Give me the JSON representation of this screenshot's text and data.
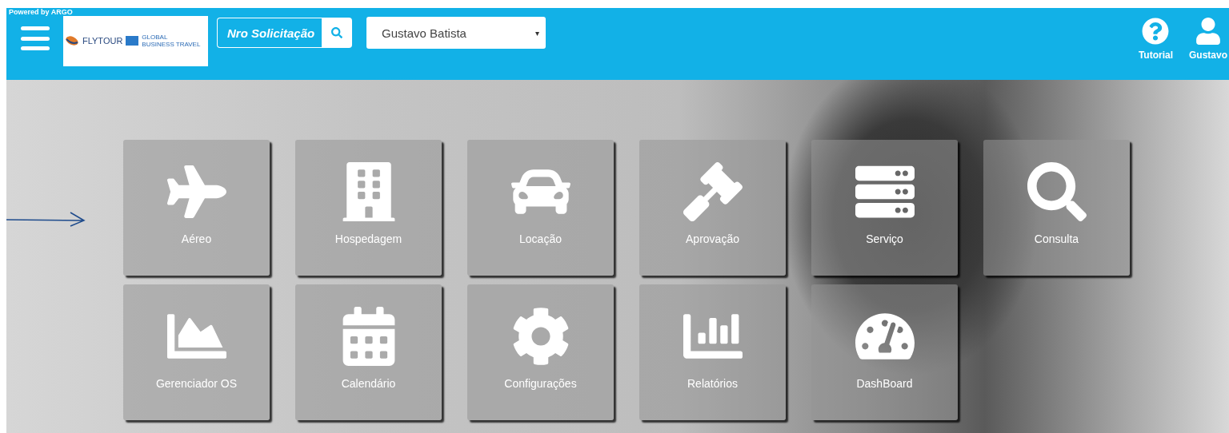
{
  "header": {
    "powered_by": "Powered by ARGO",
    "logo": {
      "brand": "FLYTOUR",
      "partner_line1": "GLOBAL",
      "partner_line2": "BUSINESS TRAVEL"
    },
    "request_search": {
      "placeholder": "Nro Solicitação"
    },
    "traveler_select": {
      "value": "Gustavo Batista",
      "caret": "▾"
    },
    "actions": [
      {
        "label": "Tutorial",
        "kind": "help"
      },
      {
        "label": "Gustavo",
        "kind": "user"
      }
    ]
  },
  "tiles": [
    {
      "label": "Aéreo"
    },
    {
      "label": "Hospedagem"
    },
    {
      "label": "Locação"
    },
    {
      "label": "Aprovação"
    },
    {
      "label": "Serviço"
    },
    {
      "label": "Consulta"
    },
    {
      "label": "Gerenciador OS"
    },
    {
      "label": "Calendário"
    },
    {
      "label": "Configurações"
    },
    {
      "label": "Relatórios"
    },
    {
      "label": "DashBoard"
    }
  ]
}
